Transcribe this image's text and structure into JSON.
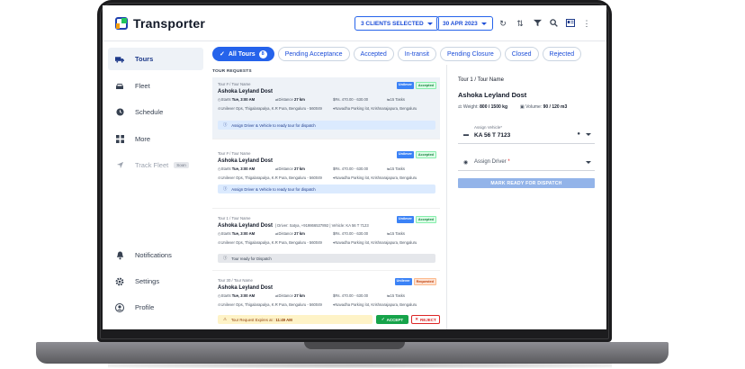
{
  "app": {
    "brand": "Transporter"
  },
  "header": {
    "clients_label": "3 CLIENTS SELECTED",
    "date_label": "30 APR 2023",
    "icons": [
      "refresh-icon",
      "sort-icon",
      "filter-icon",
      "search-icon",
      "id-card-icon",
      "more-vertical-icon"
    ]
  },
  "sidebar": {
    "items": [
      {
        "label": "Tours",
        "icon": "truck-icon",
        "active": true
      },
      {
        "label": "Fleet",
        "icon": "car-icon"
      },
      {
        "label": "Schedule",
        "icon": "clock-icon"
      },
      {
        "label": "More",
        "icon": "grid-icon"
      },
      {
        "label": "Track Fleet",
        "icon": "navigation-icon",
        "badge": "Soon",
        "disabled": true
      }
    ],
    "bottom": [
      {
        "label": "Notifications",
        "icon": "bell-icon"
      },
      {
        "label": "Settings",
        "icon": "gear-icon"
      },
      {
        "label": "Profile",
        "icon": "user-icon"
      }
    ]
  },
  "tabs": [
    {
      "label": "All Tours",
      "count": "8",
      "active": true
    },
    {
      "label": "Pending Acceptance"
    },
    {
      "label": "Accepted"
    },
    {
      "label": "In-transit"
    },
    {
      "label": "Pending Closure"
    },
    {
      "label": "Closed"
    },
    {
      "label": "Rejected"
    }
  ],
  "section_title": "TOUR REQUESTS",
  "cards": [
    {
      "sub": "Tour # / Tour Name",
      "title": "Ashoka Leyland Dost",
      "badges": [
        "Unilever",
        "Accepted"
      ],
      "starts_label": "Starts",
      "starts": "Tue, 3:00 AM",
      "distance_label": "Distance",
      "distance": "27 km",
      "price": "Rs. 470.00 - 630.00",
      "tasks": "15 Tasks",
      "from": "Unilever Ops, Thigalarapalya, K.R Pura, Bengaluru - 560049",
      "to": "Navadha Parking lot, Krishnarajapura, Bengaluru",
      "action": "Assign Driver & Vehicle to ready tour for dispatch"
    },
    {
      "sub": "Tour # / Tour Name",
      "title": "Ashoka Leyland Dost",
      "badges": [
        "Unilever",
        "Accepted"
      ],
      "starts_label": "Starts",
      "starts": "Tue, 3:00 AM",
      "distance_label": "Distance",
      "distance": "27 km",
      "price": "Rs. 470.00 - 630.00",
      "tasks": "15 Tasks",
      "from": "Unilever Ops, Thigalarapalya, K.R Pura, Bengaluru - 560049",
      "to": "Navadha Parking lot, Krishnarajapura, Bengaluru",
      "action": "Assign Driver & Vehicle to ready tour for dispatch"
    },
    {
      "sub": "Tour 1 / Tour Name",
      "title": "Ashoka Leyland Dost",
      "driver": "| Driver: Satya, +919866537892 | Vehicle: KA 56 T 7123",
      "badges": [
        "Unilever",
        "Accepted"
      ],
      "starts_label": "Starts",
      "starts": "Tue, 3:00 AM",
      "distance_label": "Distance",
      "distance": "27 km",
      "price": "Rs. 470.00 - 630.00",
      "tasks": "15 Tasks",
      "from": "Unilever Ops, Thigalarapalya, K.R Pura, Bengaluru - 560049",
      "to": "Navadha Parking lot, Krishnarajapura, Bengaluru",
      "action": "Tour ready for Dispatch"
    },
    {
      "sub": "Tour 30 / Tour Name",
      "title": "Ashoka Leyland Dost",
      "badges": [
        "Unilever",
        "Requested"
      ],
      "starts_label": "Starts",
      "starts": "Tue, 3:00 AM",
      "distance_label": "Distance",
      "distance": "27 km",
      "price": "Rs. 470.00 - 630.00",
      "tasks": "15 Tasks",
      "from": "Unilever Ops, Thigalarapalya, K.R Pura, Bengaluru - 560049",
      "to": "Navadha Parking lot, Krishnarajapura, Bengaluru",
      "action_prefix": "Tour Request Expires at :",
      "action_time": "11:49 AM",
      "accept": "ACCEPT",
      "reject": "REJECT"
    }
  ],
  "detail": {
    "breadcrumb": "Tour 1 / Tour Name",
    "title": "Ashoka Leyland Dost",
    "weight_label": "Weight:",
    "weight": "800 / 1500 kg",
    "volume_label": "Volume:",
    "volume": "90 / 120 m3",
    "vehicle_label": "Assign Vehicle*",
    "vehicle_value": "KA 56 T 7123",
    "driver_placeholder": "Assign Driver",
    "driver_required": "*",
    "mark_ready": "MARK READY FOR DISPATCH"
  },
  "colors": {
    "accent": "#2563eb",
    "accepted": "#15803d",
    "requested": "#c2410c"
  }
}
